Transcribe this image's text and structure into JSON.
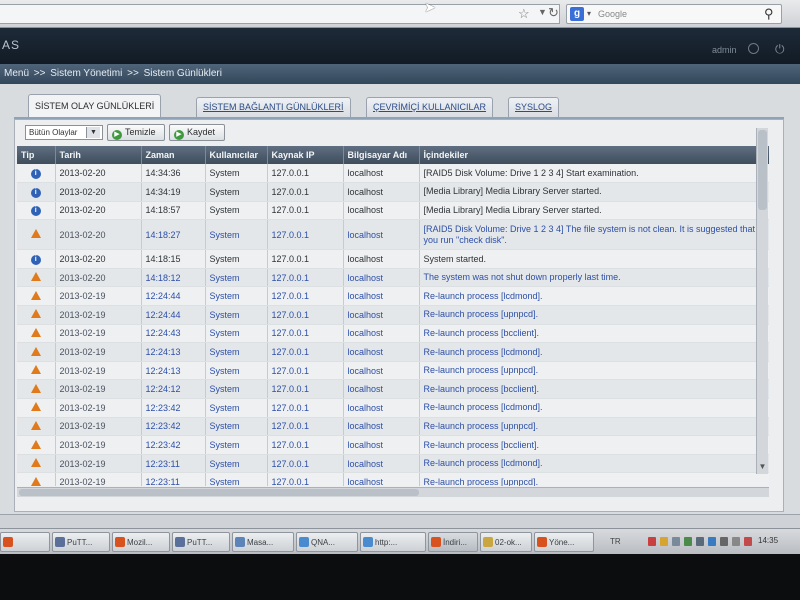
{
  "browser": {
    "search_placeholder": "Google",
    "search_engine_icon": "google-icon"
  },
  "app": {
    "logo_text": "AS",
    "user_name": "admin"
  },
  "breadcrumb": {
    "root": "Menü",
    "sep1": ">>",
    "section": "Sistem Yönetimi",
    "sep2": ">>",
    "page": "Sistem Günlükleri"
  },
  "tabs": [
    {
      "label": "SİSTEM OLAY GÜNLÜKLERİ",
      "active": true
    },
    {
      "label": "SİSTEM BAĞLANTI GÜNLÜKLERİ",
      "active": false
    },
    {
      "label": "ÇEVRİMİÇİ KULLANICILAR",
      "active": false
    },
    {
      "label": "SYSLOG",
      "active": false
    }
  ],
  "toolbar": {
    "filter_value": "Bütün Olaylar",
    "refresh_label": "Temizle",
    "save_label": "Kaydet"
  },
  "table": {
    "columns": [
      "Tip",
      "Tarih",
      "Zaman",
      "Kullanıcılar",
      "Kaynak IP",
      "Bilgisayar Adı",
      "İçindekiler"
    ],
    "rows": [
      {
        "type": "info",
        "date": "2013-02-20",
        "time": "14:34:36",
        "user": "System",
        "ip": "127.0.0.1",
        "host": "localhost",
        "content": "[RAID5 Disk Volume: Drive 1 2 3 4] Start examination."
      },
      {
        "type": "info",
        "date": "2013-02-20",
        "time": "14:34:19",
        "user": "System",
        "ip": "127.0.0.1",
        "host": "localhost",
        "content": "[Media Library] Media Library Server started."
      },
      {
        "type": "info",
        "date": "2013-02-20",
        "time": "14:18:57",
        "user": "System",
        "ip": "127.0.0.1",
        "host": "localhost",
        "content": "[Media Library] Media Library Server started."
      },
      {
        "type": "warning",
        "date": "2013-02-20",
        "time": "14:18:27",
        "user": "System",
        "ip": "127.0.0.1",
        "host": "localhost",
        "content": "[RAID5 Disk Volume: Drive 1 2 3 4] The file system is not clean. It is suggested that you run \"check disk\"."
      },
      {
        "type": "info",
        "date": "2013-02-20",
        "time": "14:18:15",
        "user": "System",
        "ip": "127.0.0.1",
        "host": "localhost",
        "content": "System started."
      },
      {
        "type": "warning",
        "date": "2013-02-20",
        "time": "14:18:12",
        "user": "System",
        "ip": "127.0.0.1",
        "host": "localhost",
        "content": "The system was not shut down properly last time."
      },
      {
        "type": "warning",
        "date": "2013-02-19",
        "time": "12:24:44",
        "user": "System",
        "ip": "127.0.0.1",
        "host": "localhost",
        "content": "Re-launch process [lcdmond]."
      },
      {
        "type": "warning",
        "date": "2013-02-19",
        "time": "12:24:44",
        "user": "System",
        "ip": "127.0.0.1",
        "host": "localhost",
        "content": "Re-launch process [upnpcd]."
      },
      {
        "type": "warning",
        "date": "2013-02-19",
        "time": "12:24:43",
        "user": "System",
        "ip": "127.0.0.1",
        "host": "localhost",
        "content": "Re-launch process [bcclient]."
      },
      {
        "type": "warning",
        "date": "2013-02-19",
        "time": "12:24:13",
        "user": "System",
        "ip": "127.0.0.1",
        "host": "localhost",
        "content": "Re-launch process [lcdmond]."
      },
      {
        "type": "warning",
        "date": "2013-02-19",
        "time": "12:24:13",
        "user": "System",
        "ip": "127.0.0.1",
        "host": "localhost",
        "content": "Re-launch process [upnpcd]."
      },
      {
        "type": "warning",
        "date": "2013-02-19",
        "time": "12:24:12",
        "user": "System",
        "ip": "127.0.0.1",
        "host": "localhost",
        "content": "Re-launch process [bcclient]."
      },
      {
        "type": "warning",
        "date": "2013-02-19",
        "time": "12:23:42",
        "user": "System",
        "ip": "127.0.0.1",
        "host": "localhost",
        "content": "Re-launch process [lcdmond]."
      },
      {
        "type": "warning",
        "date": "2013-02-19",
        "time": "12:23:42",
        "user": "System",
        "ip": "127.0.0.1",
        "host": "localhost",
        "content": "Re-launch process [upnpcd]."
      },
      {
        "type": "warning",
        "date": "2013-02-19",
        "time": "12:23:42",
        "user": "System",
        "ip": "127.0.0.1",
        "host": "localhost",
        "content": "Re-launch process [bcclient]."
      },
      {
        "type": "warning",
        "date": "2013-02-19",
        "time": "12:23:11",
        "user": "System",
        "ip": "127.0.0.1",
        "host": "localhost",
        "content": "Re-launch process [lcdmond]."
      },
      {
        "type": "warning",
        "date": "2013-02-19",
        "time": "12:23:11",
        "user": "System",
        "ip": "127.0.0.1",
        "host": "localhost",
        "content": "Re-launch process [upnpcd]."
      }
    ]
  },
  "taskbar": {
    "tasks": [
      {
        "label": "",
        "icon": "firefox-icon",
        "color": "#d8521f"
      },
      {
        "label": "PuTT...",
        "icon": "putty-icon",
        "color": "#5a6f9a"
      },
      {
        "label": "Mozil...",
        "icon": "firefox-icon",
        "color": "#d8521f"
      },
      {
        "label": "PuTT...",
        "icon": "putty-icon",
        "color": "#5a6f9a"
      },
      {
        "label": "Masa...",
        "icon": "folder-icon",
        "color": "#5d84b8"
      },
      {
        "label": "QNA...",
        "icon": "globe-icon",
        "color": "#4a8bd0"
      },
      {
        "label": "http:...",
        "icon": "globe-icon",
        "color": "#4a8bd0"
      },
      {
        "label": "İndiri...",
        "icon": "download-icon",
        "color": "#d8521f"
      },
      {
        "label": "02-ok...",
        "icon": "folder-icon",
        "color": "#c9a640"
      },
      {
        "label": "Yöne...",
        "icon": "firefox-icon",
        "color": "#d8521f"
      }
    ],
    "language": "TR",
    "clock": "14:35"
  },
  "colors": {
    "header_bg": "#1d2a38",
    "table_header": "#4a5a6b",
    "info_icon": "#2f62b6",
    "warning_icon": "#e07a1a",
    "warning_text": "#2c4fa8"
  }
}
